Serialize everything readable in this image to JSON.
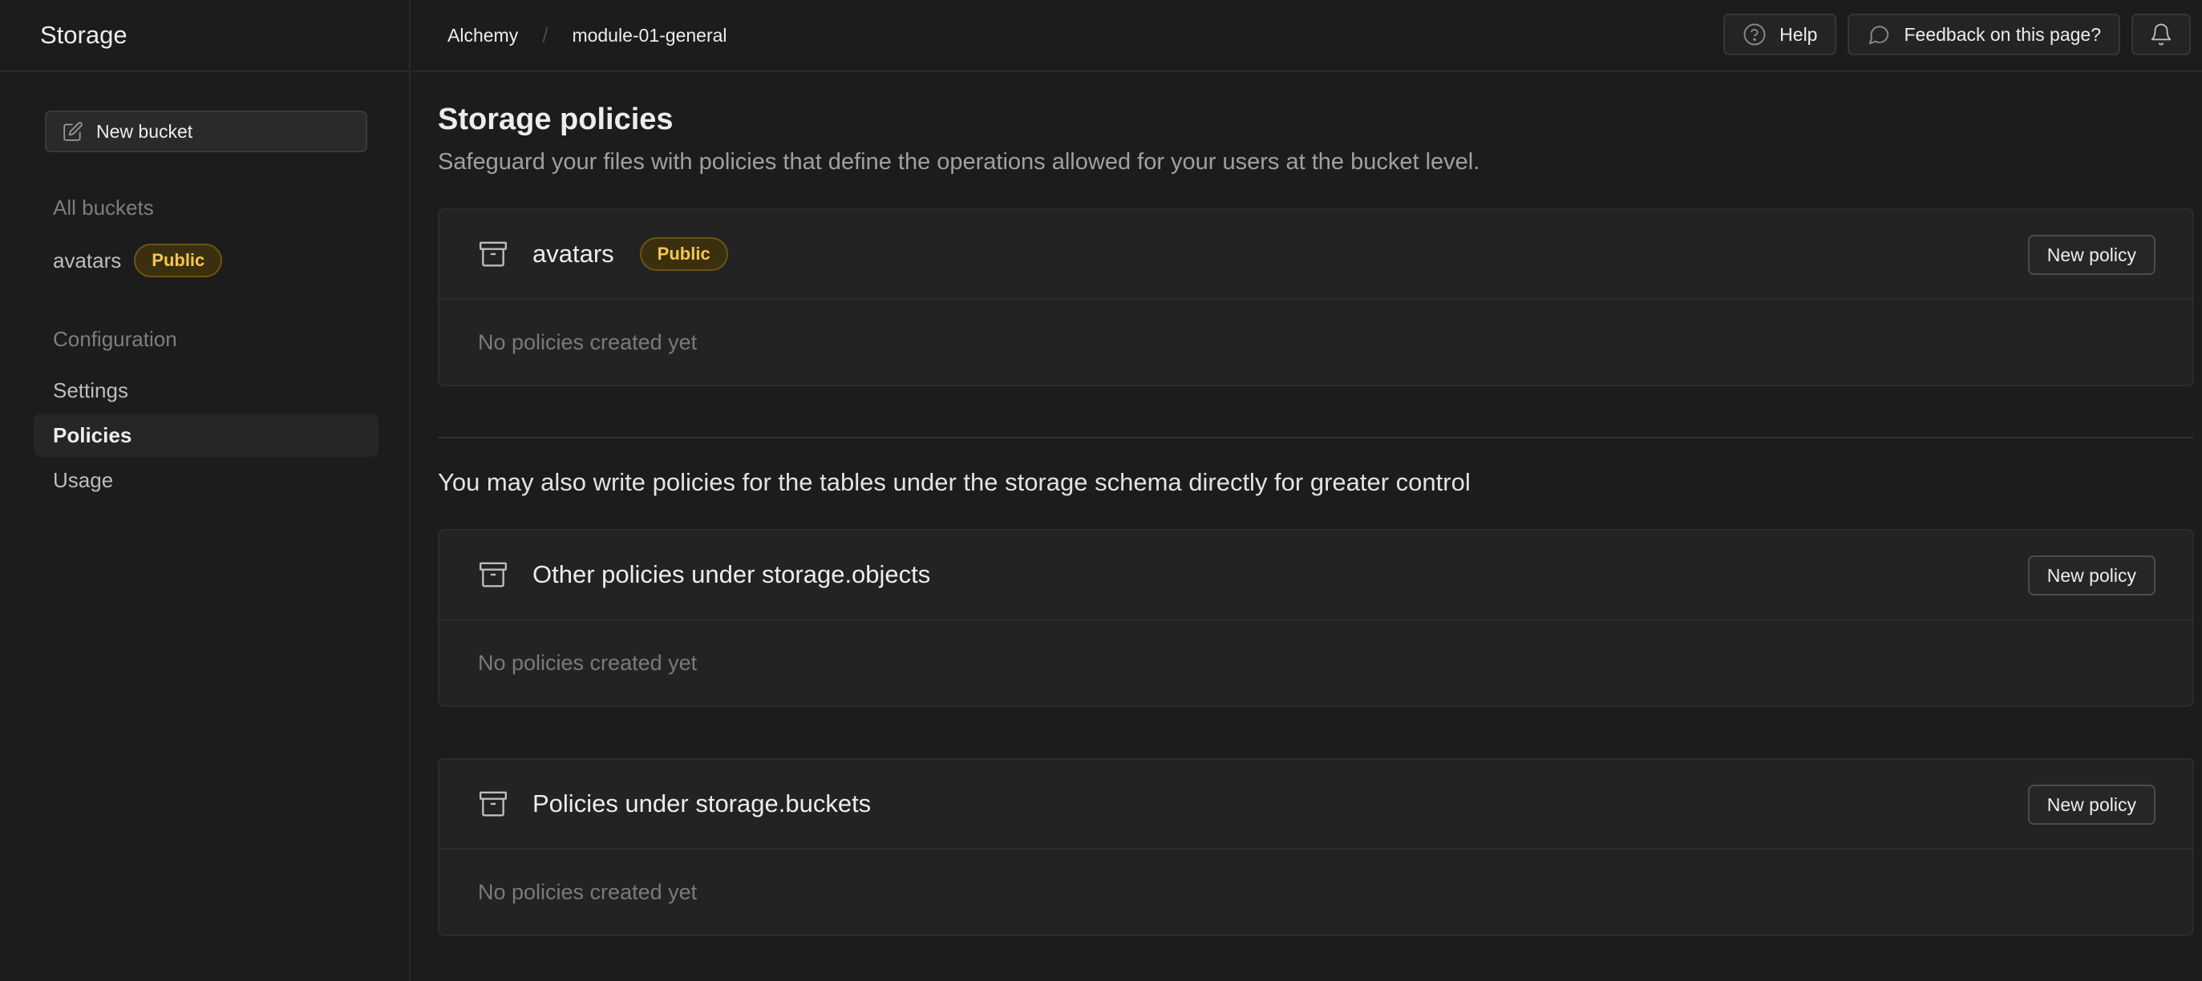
{
  "sidebar": {
    "title": "Storage",
    "new_bucket_label": "New bucket",
    "all_buckets_label": "All buckets",
    "buckets": [
      {
        "name": "avatars",
        "badge": "Public"
      }
    ],
    "configuration_label": "Configuration",
    "config_items": [
      {
        "label": "Settings",
        "active": false
      },
      {
        "label": "Policies",
        "active": true
      },
      {
        "label": "Usage",
        "active": false
      }
    ]
  },
  "topbar": {
    "breadcrumb": [
      "Alchemy",
      "module-01-general"
    ],
    "help_label": "Help",
    "feedback_label": "Feedback on this page?"
  },
  "main": {
    "title": "Storage policies",
    "subtitle": "Safeguard your files with policies that define the operations allowed for your users at the bucket level.",
    "info_text": "You may also write policies for the tables under the storage schema directly for greater control",
    "cards": [
      {
        "title": "avatars",
        "badge": "Public",
        "button_label": "New policy",
        "empty_text": "No policies created yet"
      },
      {
        "title": "Other policies under storage.objects",
        "button_label": "New policy",
        "empty_text": "No policies created yet"
      },
      {
        "title": "Policies under storage.buckets",
        "button_label": "New policy",
        "empty_text": "No policies created yet"
      }
    ]
  },
  "colors": {
    "background": "#1c1c1c",
    "card": "#232323",
    "badge_text": "#f3c64c",
    "muted": "#7a7a7a"
  },
  "icons": {
    "new_bucket": "edit-icon",
    "help": "help-circle-icon",
    "feedback": "message-circle-icon",
    "notifications": "bell-icon",
    "card": "archive-icon"
  }
}
